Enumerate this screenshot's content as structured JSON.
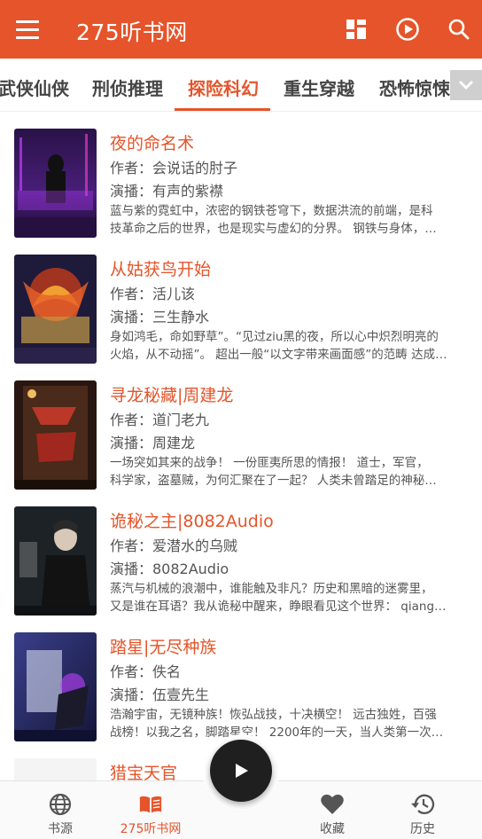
{
  "app": {
    "title": "275听书网"
  },
  "tabs": [
    "武侠仙侠",
    "刑侦推理",
    "探险科幻",
    "重生穿越",
    "恐怖惊悚"
  ],
  "books": [
    {
      "title": "夜的命名术",
      "author": "作者：会说话的肘子",
      "narrator": "演播：有声的紫襟",
      "desc1": "蓝与紫的霓虹中，浓密的钢铁苍穹下，数据洪流的前端，是科",
      "desc2": "技革命之后的世界，也是现实与虚幻的分界。 钢铁与身体，…"
    },
    {
      "title": "从姑获鸟开始",
      "author": "作者：活儿该",
      "narrator": "演播：三生静水",
      "desc1": "身如鸿毛，命如野草”。“见过ziu黑的夜，所以心中炽烈明亮的",
      "desc2": "火焰，从不动摇”。 超出一般“以文字带来画面感”的范畴 达成…"
    },
    {
      "title": "寻龙秘藏|周建龙",
      "author": "作者：道门老九",
      "narrator": "演播：周建龙",
      "desc1": "一场突如其来的战争！ 一份匪夷所思的情报！ 道士，军官，",
      "desc2": "科学家，盗墓贼，为何汇聚在了一起？ 人类未曾踏足的神秘…"
    },
    {
      "title": "诡秘之主|8082Audio",
      "author": "作者：爱潜水的乌贼",
      "narrator": "演播：8082Audio",
      "desc1": "蒸汽与机械的浪潮中，谁能触及非凡？历史和黑暗的迷雾里，",
      "desc2": "又是谁在耳语？我从诡秘中醒来，睁眼看见这个世界： qiang…"
    },
    {
      "title": "踏星|无尽种族",
      "author": "作者：佚名",
      "narrator": "演播：伍壹先生",
      "desc1": "浩瀚宇宙，无镜种族！恢弘战技，十决横空！ 远古独姓，百强",
      "desc2": "战榜！以我之名，脚踏星空！ 2200年的一天，当人类第一次…"
    },
    {
      "title": "猎宝天官",
      "author": "",
      "narrator": "",
      "desc1": "",
      "desc2": ""
    }
  ],
  "nav": [
    {
      "label": "书源",
      "icon": "globe-icon"
    },
    {
      "label": "275听书网",
      "icon": "book-icon"
    },
    {
      "label": "收藏",
      "icon": "heart-icon"
    },
    {
      "label": "历史",
      "icon": "history-icon"
    }
  ],
  "colors": {
    "primary": "#e5542a"
  }
}
